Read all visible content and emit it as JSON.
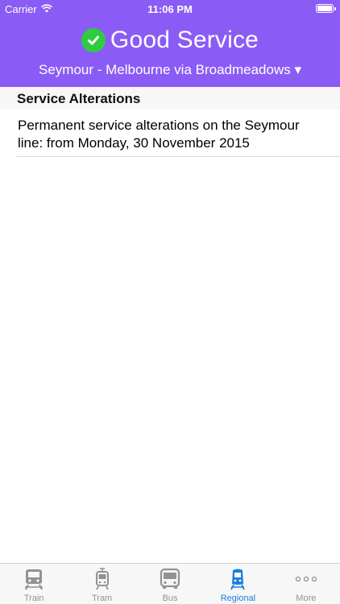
{
  "status_bar": {
    "carrier": "Carrier",
    "time": "11:06 PM"
  },
  "header": {
    "title": "Good Service",
    "line": "Seymour - Melbourne via Broadmeadows ▾",
    "color": "#8a5cf5",
    "status_icon": "checkmark-circle-icon",
    "status_color": "#2ecc40"
  },
  "section": {
    "title": "Service Alterations",
    "items": [
      {
        "text": "Permanent service alterations on the Seymour line: from Monday, 30 November 2015"
      }
    ]
  },
  "tabs": [
    {
      "label": "Train",
      "icon": "train-icon",
      "active": false
    },
    {
      "label": "Tram",
      "icon": "tram-icon",
      "active": false
    },
    {
      "label": "Bus",
      "icon": "bus-icon",
      "active": false
    },
    {
      "label": "Regional",
      "icon": "regional-train-icon",
      "active": true
    },
    {
      "label": "More",
      "icon": "more-icon",
      "active": false
    }
  ],
  "colors": {
    "active_tab": "#1a7fe0",
    "inactive_tab": "#929292"
  }
}
